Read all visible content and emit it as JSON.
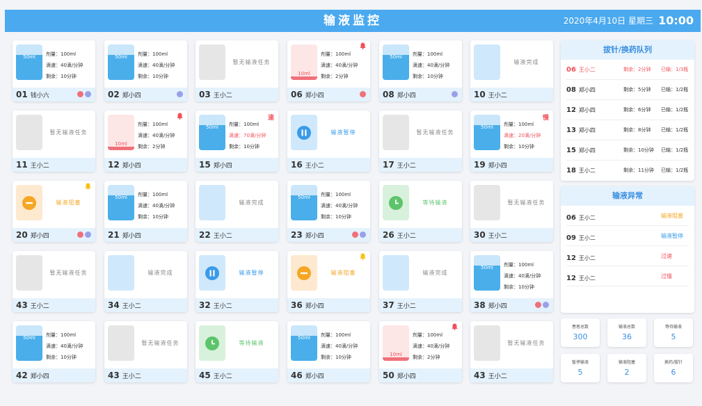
{
  "header": {
    "title": "输液监控",
    "date": "2020年4月10日 星期三",
    "time": "10:00"
  },
  "colors": {
    "accent": "#4aa9ef",
    "warning": "#f5a623",
    "danger": "#f0505a",
    "wait": "#5cc46b"
  },
  "cards": [
    {
      "bed": "01",
      "name": "钱小六",
      "type": "info",
      "volume": "50ml",
      "dose": "剂量：100ml",
      "rate": "滴速：40滴/分钟",
      "remain": "剩余：10分钟",
      "badges": [
        "#f0707a",
        "#9aa0e8"
      ]
    },
    {
      "bed": "02",
      "name": "郑小四",
      "type": "info",
      "volume": "50ml",
      "dose": "剂量：100ml",
      "rate": "滴速：40滴/分钟",
      "remain": "剩余：10分钟",
      "badges": [
        "#9aa0e8"
      ]
    },
    {
      "bed": "03",
      "name": "王小二",
      "type": "empty",
      "text": "暂无输液任务"
    },
    {
      "bed": "06",
      "name": "郑小四",
      "type": "low",
      "volume": "10ml",
      "dose": "剂量：100ml",
      "rate": "滴速：40滴/分钟",
      "remain": "剩余：2分钟",
      "corner": "bell-red",
      "badges": [
        "#f0707a"
      ]
    },
    {
      "bed": "08",
      "name": "郑小四",
      "type": "info",
      "volume": "50ml",
      "dose": "剂量：100ml",
      "rate": "滴速：40滴/分钟",
      "remain": "剩余：10分钟",
      "badges": [
        "#9aa0e8"
      ]
    },
    {
      "bed": "10",
      "name": "王小二",
      "type": "done",
      "text": "输液完成"
    },
    {
      "bed": "11",
      "name": "王小二",
      "type": "empty",
      "text": "暂无输液任务"
    },
    {
      "bed": "12",
      "name": "郑小四",
      "type": "low",
      "volume": "10ml",
      "dose": "剂量：100ml",
      "rate": "滴速：40滴/分钟",
      "remain": "剩余：2分钟",
      "corner": "bell-red"
    },
    {
      "bed": "15",
      "name": "郑小四",
      "type": "info",
      "volume": "50ml",
      "dose": "剂量：100ml",
      "rate": "滴速：70滴/分钟",
      "rateRed": true,
      "remain": "剩余：10分钟",
      "corner": "速"
    },
    {
      "bed": "16",
      "name": "王小二",
      "type": "paused",
      "text": "输液暂停"
    },
    {
      "bed": "17",
      "name": "王小二",
      "type": "empty",
      "text": "暂无输液任务"
    },
    {
      "bed": "19",
      "name": "郑小四",
      "type": "info",
      "volume": "50ml",
      "dose": "剂量：100ml",
      "rate": "滴速：20滴/分钟",
      "rateRed": true,
      "remain": "剩余：10分钟",
      "corner": "慢"
    },
    {
      "bed": "20",
      "name": "郑小四",
      "type": "blocked",
      "text": "输液阻塞",
      "corner": "bell-yellow",
      "badges": [
        "#f0707a",
        "#9aa0e8"
      ]
    },
    {
      "bed": "21",
      "name": "郑小四",
      "type": "info",
      "volume": "50ml",
      "dose": "剂量：100ml",
      "rate": "滴速：40滴/分钟",
      "remain": "剩余：10分钟"
    },
    {
      "bed": "22",
      "name": "王小二",
      "type": "done",
      "text": "输液完成"
    },
    {
      "bed": "23",
      "name": "郑小四",
      "type": "info",
      "volume": "50ml",
      "dose": "剂量：100ml",
      "rate": "滴速：40滴/分钟",
      "remain": "剩余：10分钟",
      "badges": [
        "#f0707a",
        "#9aa0e8"
      ]
    },
    {
      "bed": "26",
      "name": "王小二",
      "type": "waiting",
      "text": "等待输液"
    },
    {
      "bed": "30",
      "name": "王小二",
      "type": "empty",
      "text": "暂无输液任务"
    },
    {
      "bed": "43",
      "name": "王小二",
      "type": "empty",
      "text": "暂无输液任务"
    },
    {
      "bed": "34",
      "name": "王小二",
      "type": "done",
      "text": "输液完成"
    },
    {
      "bed": "32",
      "name": "王小二",
      "type": "paused",
      "text": "输液暂停"
    },
    {
      "bed": "36",
      "name": "郑小四",
      "type": "blocked",
      "text": "输液阻塞",
      "corner": "bell-yellow"
    },
    {
      "bed": "37",
      "name": "王小二",
      "type": "done",
      "text": "输液完成"
    },
    {
      "bed": "38",
      "name": "郑小四",
      "type": "info",
      "volume": "50ml",
      "dose": "剂量：100ml",
      "rate": "滴速：40滴/分钟",
      "remain": "剩余：10分钟",
      "badges": [
        "#f0707a",
        "#9aa0e8"
      ]
    },
    {
      "bed": "42",
      "name": "郑小四",
      "type": "info",
      "volume": "50ml",
      "dose": "剂量：100ml",
      "rate": "滴速：40滴/分钟",
      "remain": "剩余：10分钟"
    },
    {
      "bed": "43",
      "name": "王小二",
      "type": "empty",
      "text": "暂无输液任务"
    },
    {
      "bed": "45",
      "name": "王小二",
      "type": "waiting",
      "text": "等待输液"
    },
    {
      "bed": "46",
      "name": "郑小四",
      "type": "info",
      "volume": "50ml",
      "dose": "剂量：100ml",
      "rate": "滴速：40滴/分钟",
      "remain": "剩余：10分钟"
    },
    {
      "bed": "50",
      "name": "郑小四",
      "type": "low",
      "volume": "10ml",
      "dose": "剂量：100ml",
      "rate": "滴速：40滴/分钟",
      "remain": "剩余：2分钟",
      "corner": "bell-red"
    },
    {
      "bed": "43",
      "name": "王小二",
      "type": "empty",
      "text": "暂无输液任务"
    }
  ],
  "queue": {
    "title": "拔针/换药队列",
    "items": [
      {
        "bed": "06",
        "name": "王小二",
        "remain": "剩余：2分钟",
        "count": "已输：1/3瓶",
        "alert": true
      },
      {
        "bed": "08",
        "name": "郑小四",
        "remain": "剩余：5分钟",
        "count": "已输：1/2瓶"
      },
      {
        "bed": "12",
        "name": "郑小四",
        "remain": "剩余：6分钟",
        "count": "已输：1/2瓶"
      },
      {
        "bed": "13",
        "name": "郑小四",
        "remain": "剩余：8分钟",
        "count": "已输：1/2瓶"
      },
      {
        "bed": "15",
        "name": "郑小四",
        "remain": "剩余：10分钟",
        "count": "已输：1/2瓶"
      },
      {
        "bed": "18",
        "name": "王小二",
        "remain": "剩余：11分钟",
        "count": "已输：1/2瓶"
      }
    ]
  },
  "abnormal": {
    "title": "输液异常",
    "items": [
      {
        "bed": "06",
        "name": "王小二",
        "status": "输液阻塞",
        "color": "#f5a623"
      },
      {
        "bed": "09",
        "name": "王小二",
        "status": "输液暂停",
        "color": "#3a9be8"
      },
      {
        "bed": "12",
        "name": "王小二",
        "status": "过速",
        "color": "#f0505a"
      },
      {
        "bed": "12",
        "name": "王小二",
        "status": "过慢",
        "color": "#f0505a"
      }
    ]
  },
  "stats": [
    {
      "label": "患者总数",
      "value": "300"
    },
    {
      "label": "输液总数",
      "value": "36"
    },
    {
      "label": "等待输液",
      "value": "5"
    },
    {
      "label": "暂停输液",
      "value": "5"
    },
    {
      "label": "输液阻塞",
      "value": "2"
    },
    {
      "label": "换药/拔针",
      "value": "6"
    }
  ]
}
